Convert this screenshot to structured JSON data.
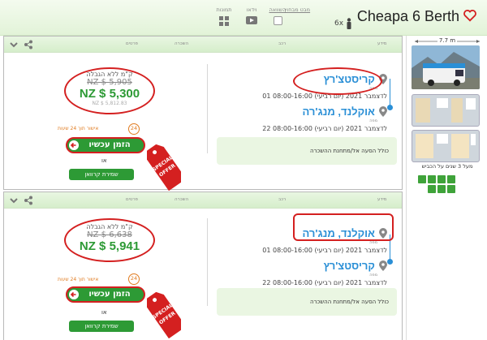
{
  "header": {
    "title": "Cheapa 6 Berth",
    "sleeps": "6x",
    "icons": [
      {
        "label": "מבט מבחוץ",
        "icon": "exterior-view"
      },
      {
        "label": "השוואה",
        "icon": "compare-checkbox"
      },
      {
        "label": "וידאו",
        "icon": "video-icon"
      },
      {
        "label": "תמונות",
        "icon": "gallery-icon"
      }
    ]
  },
  "vehicle": {
    "length": "7.7 m",
    "years": "מעל 3 שנים על הכביש"
  },
  "cards": [
    {
      "head_labels": [
        "מידע",
        "רכב",
        "השכרה",
        "פרטים"
      ],
      "pickup": {
        "location": "קריסטצ'רץ",
        "map_label": "מפה",
        "datetime": "01 לדצמבר 2021 (יום רביעי) 08:00-16:00"
      },
      "dropoff": {
        "location": "אוקלנד, מנג'רה",
        "map_label": "מפה",
        "datetime": "22 לדצמבר 2021 (יום רביעי) 08:00-16:00"
      },
      "included": "כולל הסעה אל/מתחנת ההשכרה",
      "unlimited": "ק\"מ ללא הגבלה",
      "old_price": "NZ $ 5,905",
      "new_price": "NZ $ 5,300",
      "small_price": "NZ $ 5,812.83",
      "cancel_text": "אישור תוך 24 שעות",
      "badge": "24",
      "book_now": "הזמן עכשיו",
      "or": "או",
      "save_quote": "שמירת קרוואן",
      "special": [
        "SPECIAL",
        "OFFER"
      ]
    },
    {
      "head_labels": [
        "מידע",
        "רכב",
        "השכרה",
        "פרטים"
      ],
      "pickup": {
        "location": "אוקלנד, מנג'רה",
        "map_label": "מפה",
        "datetime": "01 לדצמבר 2021 (יום רביעי) 08:00-16:00"
      },
      "dropoff": {
        "location": "קריסטצ'רץ",
        "map_label": "מפה",
        "datetime": "22 לדצמבר 2021 (יום רביעי) 08:00-16:00"
      },
      "included": "כולל הסעה אל/מתחנת ההשכרה",
      "unlimited": "ק\"מ ללא הגבלה",
      "old_price": "NZ $ 6,638",
      "new_price": "NZ $ 5,941",
      "small_price": "",
      "cancel_text": "אישור תוך 24 שעות",
      "badge": "24",
      "book_now": "הזמן עכשיו",
      "or": "או",
      "save_quote": "שמירת קרוואן",
      "special": [
        "SPECIAL",
        "OFFER"
      ]
    }
  ],
  "colors": {
    "accent_green": "#2d9a35",
    "link_blue": "#2a8fd6",
    "highlight_red": "#d42020",
    "orange": "#e07b20"
  }
}
